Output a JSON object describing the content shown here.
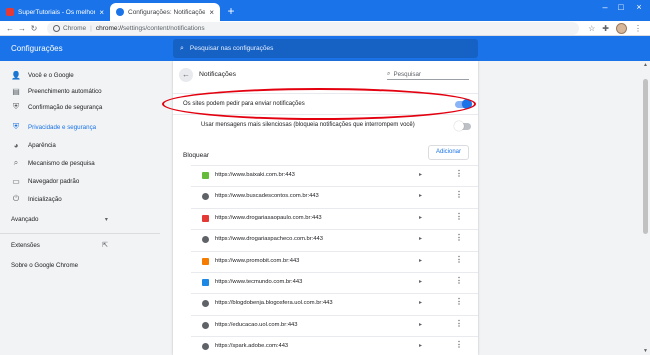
{
  "tabs": [
    {
      "title": "SuperTutoriais - Os melhores tuto",
      "close": "×"
    },
    {
      "title": "Configurações: Notificações",
      "close": "×"
    }
  ],
  "new_tab": "+",
  "window_controls": {
    "minimize": "–",
    "maximize": "□",
    "close": "×"
  },
  "toolbar": {
    "back": "←",
    "forward": "→",
    "reload": "↻",
    "origin": "Chrome",
    "url_scheme": "chrome://",
    "url_path": "settings/content/notifications",
    "star": "☆",
    "extensions": "✚",
    "menu": "⋮"
  },
  "header": {
    "title": "Configurações",
    "search_placeholder": "Pesquisar nas configurações"
  },
  "sidebar": {
    "items": [
      {
        "label": "Você e o Google",
        "icon": "person-icon",
        "glyph": "👤",
        "selected": false
      },
      {
        "label": "Preenchimento automático",
        "icon": "assignment-icon",
        "glyph": "▤",
        "selected": false
      },
      {
        "label": "Confirmação de segurança",
        "icon": "shield-check-icon",
        "glyph": "⛨",
        "selected": false
      },
      {
        "label": "Privacidade e segurança",
        "icon": "shield-icon",
        "glyph": "⛨",
        "selected": true
      },
      {
        "label": "Aparência",
        "icon": "palette-icon",
        "glyph": "◕",
        "selected": false
      },
      {
        "label": "Mecanismo de pesquisa",
        "icon": "search-icon",
        "glyph": "⌕",
        "selected": false
      },
      {
        "label": "Navegador padrão",
        "icon": "browser-icon",
        "glyph": "▭",
        "selected": false
      },
      {
        "label": "Inicialização",
        "icon": "power-icon",
        "glyph": "⏻",
        "selected": false
      }
    ],
    "advanced": "Avançado",
    "advanced_chevron": "▾",
    "extensions": "Extensões",
    "extensions_link_icon": "⇱",
    "about": "Sobre o Google Chrome"
  },
  "main": {
    "back": "←",
    "title": "Notificações",
    "search_placeholder": "Pesquisar",
    "search_glyph": "⌕",
    "ask_label": "Os sites podem pedir para enviar notificações",
    "ask_enabled": true,
    "quiet_label": "Usar mensagens mais silenciosas (bloqueia notificações que interrompem você)",
    "quiet_enabled": false,
    "block_title": "Bloquear",
    "add_button": "Adicionar",
    "arrow_glyph": "▸",
    "more_glyph": "⋮",
    "blocked_sites": [
      {
        "url": "https://www.baixaki.com.br:443",
        "icon": "baixaki-icon",
        "color": "#66bb3a"
      },
      {
        "url": "https://www.buscadescontos.com.br:443",
        "icon": "globe-icon",
        "color": "#5f6368"
      },
      {
        "url": "https://www.drogariasaopaulo.com.br:443",
        "icon": "drogaria-icon",
        "color": "#e53935"
      },
      {
        "url": "https://www.drogariaspacheco.com.br:443",
        "icon": "globe-icon",
        "color": "#5f6368"
      },
      {
        "url": "https://www.promobit.com.br:443",
        "icon": "promobit-icon",
        "color": "#f57c00"
      },
      {
        "url": "https://www.tecmundo.com.br:443",
        "icon": "tecmundo-icon",
        "color": "#1e88e5"
      },
      {
        "url": "https://blogdobenja.blogosfera.uol.com.br:443",
        "icon": "globe-icon",
        "color": "#5f6368"
      },
      {
        "url": "https://educacao.uol.com.br:443",
        "icon": "globe-icon",
        "color": "#5f6368"
      },
      {
        "url": "https://spark.adobe.com:443",
        "icon": "globe-icon",
        "color": "#5f6368"
      }
    ]
  },
  "colors": {
    "accent": "#1a73e8",
    "annotation": "#e3000f"
  }
}
